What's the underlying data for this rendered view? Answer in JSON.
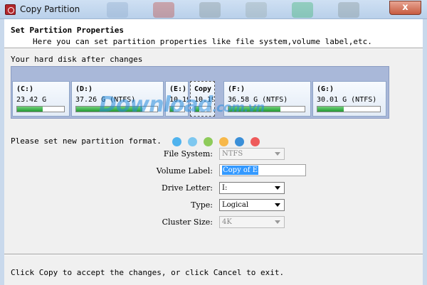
{
  "window": {
    "title": "Copy Partition",
    "close_glyph": "x"
  },
  "header": {
    "title": "Set Partition Properties",
    "subtitle": "Here you can set partition properties like file system,volume label,etc."
  },
  "disk": {
    "caption": "Your hard disk after changes",
    "partitions": [
      {
        "label": "(C:)",
        "size": "23.42 G",
        "used_fraction": 0.55
      },
      {
        "label": "(D:)",
        "size": "37.26 G  (NTFS)",
        "used_fraction": 0.82
      },
      {
        "label": "(E:)",
        "size": "10.19",
        "used_fraction": 0.25
      },
      {
        "label": "Copy",
        "size": "10.19",
        "used_fraction": 0.25
      },
      {
        "label": "(F:)",
        "size": "36.58 G  (NTFS)",
        "used_fraction": 0.68
      },
      {
        "label": "(G:)",
        "size": "30.01 G  (NTFS)",
        "used_fraction": 0.42
      }
    ]
  },
  "watermark": {
    "main": "Download",
    "tld": ".com.vn"
  },
  "form": {
    "prompt": "Please set new partition format.",
    "file_system": {
      "label": "File System:",
      "value": "NTFS"
    },
    "volume_label": {
      "label": "Volume Label:",
      "value": "Copy of E"
    },
    "drive_letter": {
      "label": "Drive Letter:",
      "value": "I:"
    },
    "type": {
      "label": "Type:",
      "value": "Logical"
    },
    "cluster_size": {
      "label": "Cluster Size:",
      "value": "4K"
    }
  },
  "footer": {
    "hint": "Click Copy to accept the changes, or click Cancel to exit."
  },
  "colors": {
    "disk_bg": "#a9b8d9",
    "bar_fill": "#229a33",
    "selection": "#3399ff",
    "dots": [
      "#4fb3ee",
      "#7ec8f0",
      "#8ecb5a",
      "#f7b84a",
      "#3a8fd8",
      "#ee5a5a"
    ]
  }
}
